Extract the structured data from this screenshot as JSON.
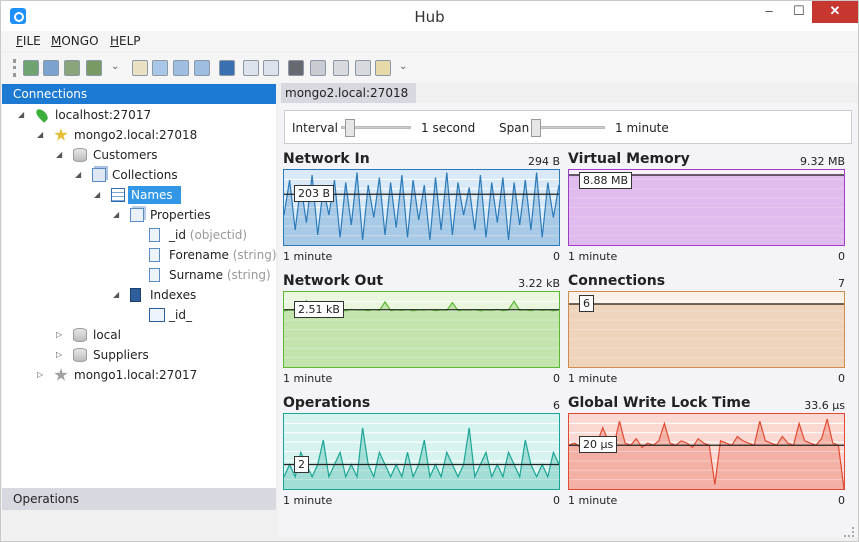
{
  "window": {
    "title": "Hub",
    "min": "–",
    "max": "☐",
    "close": "✕"
  },
  "menu": [
    {
      "label": "FILE",
      "accel": "F",
      "rest": "ILE"
    },
    {
      "label": "MONGO",
      "accel": "M",
      "rest": "ONGO"
    },
    {
      "label": "HELP",
      "accel": "H",
      "rest": "ELP"
    }
  ],
  "toolbar": {
    "buttons": [
      "add-server-icon",
      "remove-server-icon",
      "import-icon",
      "export-icon",
      "search-icon",
      "collection-icon",
      "add-collection-icon",
      "remove-collection-icon",
      "database-icon",
      "document-icon",
      "new-document-icon",
      "shell-icon",
      "settings-icon",
      "add-icon",
      "delete-icon",
      "copy-icon"
    ],
    "overflow": "⌄"
  },
  "connections": {
    "header": "Connections",
    "tree": [
      {
        "label": "localhost:27017",
        "type": "",
        "icon": "leaf-icon",
        "expanded": true
      },
      {
        "label": "mongo2.local:27018",
        "type": "",
        "icon": "star-server-icon",
        "expanded": true
      },
      {
        "label": "Customers",
        "type": "",
        "icon": "database-icon",
        "expanded": true
      },
      {
        "label": "Collections",
        "type": "",
        "icon": "collections-icon",
        "expanded": true
      },
      {
        "label": "Names",
        "type": "",
        "icon": "table-icon",
        "expanded": true,
        "selected": true
      },
      {
        "label": "Properties",
        "type": "",
        "icon": "properties-icon",
        "expanded": true
      },
      {
        "label": "_id",
        "type": "(objectid)",
        "icon": "field-icon"
      },
      {
        "label": "Forename",
        "type": "(string)",
        "icon": "field-icon"
      },
      {
        "label": "Surname",
        "type": "(string)",
        "icon": "field-icon"
      },
      {
        "label": "Indexes",
        "type": "",
        "icon": "indexes-icon",
        "expanded": true
      },
      {
        "label": "_id_",
        "type": "",
        "icon": "index-icon"
      },
      {
        "label": "local",
        "type": "",
        "icon": "database-icon",
        "expanded": false
      },
      {
        "label": "Suppliers",
        "type": "",
        "icon": "database-icon",
        "expanded": false
      },
      {
        "label": "mongo1.local:27017",
        "type": "",
        "icon": "star-server-grey-icon",
        "expanded": false
      }
    ]
  },
  "operations": {
    "header": "Operations"
  },
  "tab": {
    "label": "mongo2.local:27018"
  },
  "settings": {
    "interval_label": "Interval",
    "interval_value": "1 second",
    "interval_level": 0.05,
    "span_label": "Span",
    "span_value": "1 minute",
    "span_level": 0.0
  },
  "charts": [
    {
      "title": "Network In",
      "max": "294 B",
      "min": "1 minute",
      "zero": "0",
      "current": "203 B",
      "color": "#2b7bb9",
      "fill": "#d9e9f7",
      "ref": 0.69
    },
    {
      "title": "Virtual Memory",
      "max": "9.32 MB",
      "min": "1 minute",
      "zero": "0",
      "current": "8.88 MB",
      "color": "#a23bc9",
      "fill": "#f7effb",
      "ref": 0.95
    },
    {
      "title": "Network Out",
      "max": "3.22 kB",
      "min": "1 minute",
      "zero": "0",
      "current": "2.51 kB",
      "color": "#5cb833",
      "fill": "#eaf6dd",
      "ref": 0.78
    },
    {
      "title": "Connections",
      "max": "7",
      "min": "1 minute",
      "zero": "0",
      "current": "6",
      "color": "#d08b4e",
      "fill": "#fbf0e6",
      "ref": 0.86
    },
    {
      "title": "Operations",
      "max": "6",
      "min": "1 minute",
      "zero": "0",
      "current": "2",
      "color": "#1aa596",
      "fill": "#d7f3ef",
      "ref": 0.33
    },
    {
      "title": "Global Write Lock Time",
      "max": "33.6 μs",
      "min": "1 minute",
      "zero": "0",
      "current": "20 μs",
      "color": "#e04a33",
      "fill": "#fbd9d2",
      "ref": 0.6
    }
  ],
  "chart_data": [
    {
      "type": "area",
      "title": "Network In",
      "unit": "B",
      "ylim": [
        0,
        294
      ],
      "reference": 203,
      "values": [
        120,
        260,
        60,
        240,
        90,
        280,
        40,
        230,
        120,
        260,
        30,
        250,
        80,
        290,
        20,
        240,
        110,
        270,
        40,
        250,
        70,
        280,
        30,
        260,
        100,
        240,
        20,
        270,
        60,
        290,
        40,
        250,
        120,
        230,
        60,
        280,
        30,
        250,
        90,
        270,
        20,
        250,
        80,
        260,
        60,
        290,
        30,
        250,
        110,
        240
      ]
    },
    {
      "type": "area",
      "title": "Virtual Memory",
      "unit": "MB",
      "ylim": [
        0,
        9.32
      ],
      "reference": 8.88,
      "values": [
        8.88,
        8.88,
        8.88,
        8.88,
        8.88,
        8.88,
        8.88,
        8.88,
        8.88,
        8.88
      ]
    },
    {
      "type": "area",
      "title": "Network Out",
      "unit": "kB",
      "ylim": [
        0,
        3.22
      ],
      "reference": 2.51,
      "values": [
        2.45,
        2.5,
        2.48,
        2.52,
        2.9,
        2.46,
        2.5,
        2.47,
        2.51,
        2.48,
        2.5,
        2.46,
        2.52,
        2.49,
        2.5,
        2.47,
        2.51,
        2.48,
        2.85,
        2.47,
        2.5,
        2.48,
        2.51,
        2.46,
        2.5,
        2.49,
        2.51,
        2.47,
        2.5,
        2.48,
        2.82,
        2.47,
        2.5,
        2.49,
        2.51,
        2.46,
        2.5,
        2.48,
        2.52,
        2.47,
        2.5,
        2.88,
        2.48,
        2.5,
        2.47,
        2.51,
        2.48,
        2.5,
        2.46,
        2.5
      ]
    },
    {
      "type": "area",
      "title": "Connections",
      "unit": "",
      "ylim": [
        0,
        7
      ],
      "reference": 6,
      "values": [
        6,
        6,
        6,
        6,
        6,
        6,
        6,
        6,
        6,
        6
      ]
    },
    {
      "type": "area",
      "title": "Operations",
      "unit": "",
      "ylim": [
        0,
        6
      ],
      "reference": 2,
      "values": [
        1,
        2,
        1,
        3,
        2,
        1,
        2,
        4,
        1,
        2,
        3,
        1,
        2,
        1,
        5,
        2,
        1,
        3,
        2,
        1,
        2,
        1,
        3,
        1,
        2,
        4,
        1,
        2,
        1,
        3,
        2,
        1,
        2,
        5,
        1,
        2,
        3,
        1,
        2,
        1,
        3,
        2,
        1,
        4,
        2,
        1,
        2,
        1,
        3,
        2
      ]
    },
    {
      "type": "area",
      "title": "Global Write Lock Time",
      "unit": "μs",
      "ylim": [
        0,
        33.6
      ],
      "reference": 20,
      "values": [
        20,
        21,
        19,
        22,
        20,
        21,
        28,
        22,
        20,
        31,
        21,
        20,
        23,
        19,
        21,
        20,
        22,
        30,
        21,
        20,
        22,
        21,
        19,
        23,
        21,
        20,
        2,
        22,
        21,
        20,
        24,
        22,
        21,
        20,
        31,
        22,
        21,
        20,
        24,
        21,
        20,
        30,
        22,
        21,
        20,
        23,
        32,
        21,
        20,
        0
      ]
    }
  ]
}
